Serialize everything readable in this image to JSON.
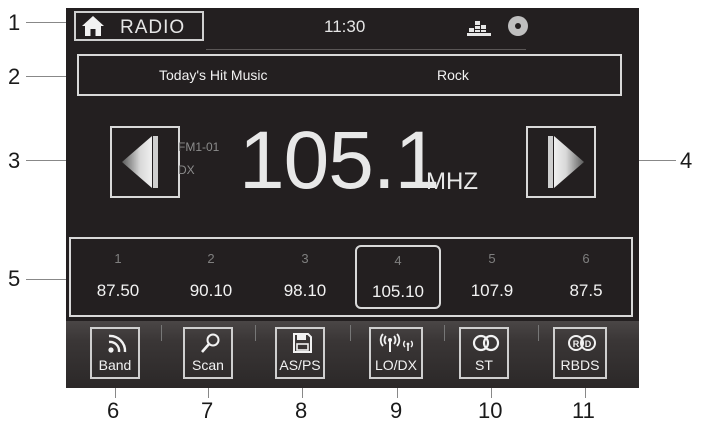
{
  "callouts": [
    "1",
    "2",
    "3",
    "4",
    "5",
    "6",
    "7",
    "8",
    "9",
    "10",
    "11"
  ],
  "topbar": {
    "home_label": "RADIO",
    "clock": "11:30",
    "icons": [
      "home-icon",
      "equalizer-icon",
      "disc-icon"
    ]
  },
  "info": {
    "station_name": "Today's Hit Music",
    "genre": "Rock"
  },
  "tuner": {
    "band": "FM1-01",
    "mode": "DX",
    "frequency": "105.1",
    "unit": "MHZ"
  },
  "presets": [
    {
      "num": "1",
      "freq": "87.50",
      "selected": false
    },
    {
      "num": "2",
      "freq": "90.10",
      "selected": false
    },
    {
      "num": "3",
      "freq": "98.10",
      "selected": false
    },
    {
      "num": "4",
      "freq": "105.10",
      "selected": true
    },
    {
      "num": "5",
      "freq": "107.9",
      "selected": false
    },
    {
      "num": "6",
      "freq": "87.5",
      "selected": false
    }
  ],
  "buttons": [
    {
      "label": "Band",
      "icon": "band-icon"
    },
    {
      "label": "Scan",
      "icon": "scan-icon"
    },
    {
      "label": "AS/PS",
      "icon": "save-icon"
    },
    {
      "label": "LO/DX",
      "icon": "antenna-icon"
    },
    {
      "label": "ST",
      "icon": "stereo-icon"
    },
    {
      "label": "RBDS",
      "icon": "rbds-icon"
    }
  ],
  "colors": {
    "screen_bg": "#231f20",
    "text": "#f2f2f2",
    "dim_text": "#7f7f7f",
    "border": "#d9d9d9"
  }
}
